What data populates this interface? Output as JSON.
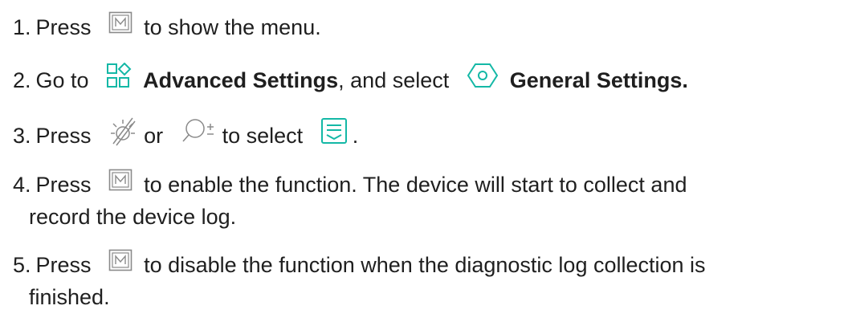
{
  "colors": {
    "accent": "#14b8a6",
    "text": "#1f1f1f",
    "key_icon": "#8a8a8a"
  },
  "steps": [
    {
      "num": "1.",
      "pre": "Press",
      "post": "to show the menu."
    },
    {
      "num": "2.",
      "pre": "Go to",
      "link1": "Advanced Settings",
      "mid": ", and select",
      "link2": "General Settings."
    },
    {
      "num": "3.",
      "pre": "Press",
      "or": "or",
      "mid": "to select",
      "post": "."
    },
    {
      "num": "4.",
      "pre": "Press",
      "post": "to enable the function. The device will start to collect and",
      "post2": "record the device log."
    },
    {
      "num": "5.",
      "pre": "Press",
      "post": "to disable the function when the diagnostic log collection is",
      "post2": "finished."
    }
  ],
  "icons": [
    "m-key-icon",
    "advanced-settings-icon",
    "general-settings-icon",
    "brightness-icon",
    "zoom-icon",
    "device-log-icon"
  ]
}
